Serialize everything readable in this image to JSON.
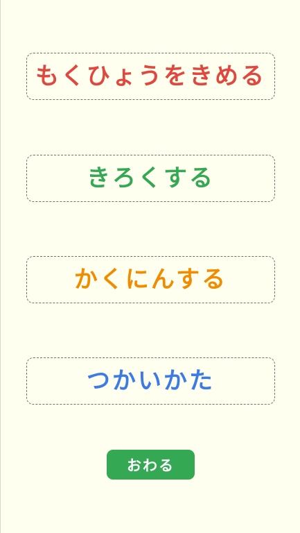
{
  "menu": {
    "goal": {
      "label": "もくひょうをきめる",
      "color": "#e0483e"
    },
    "record": {
      "label": "きろくする",
      "color": "#34a853"
    },
    "check": {
      "label": "かくにんする",
      "color": "#f08c00"
    },
    "howto": {
      "label": "つかいかた",
      "color": "#3b7be3"
    }
  },
  "end_button": {
    "label": "おわる",
    "color": "#34a853"
  },
  "background_color": "#fffff0"
}
